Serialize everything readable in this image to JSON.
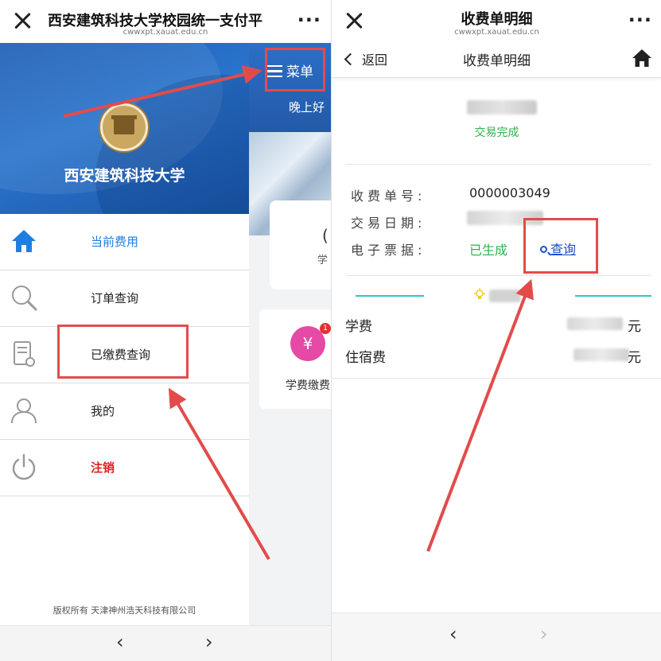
{
  "left_phone": {
    "title": "西安建筑科技大学校园统一支付平",
    "url": "cwwxpt.xauat.edu.cn",
    "more": "···",
    "school_name": "西安建筑科技大学",
    "menu_items": [
      {
        "label": "当前费用",
        "icon": "home-icon"
      },
      {
        "label": "订单查询",
        "icon": "search-icon"
      },
      {
        "label": "已缴费查询",
        "icon": "receipt-icon"
      },
      {
        "label": "我的",
        "icon": "user-icon"
      },
      {
        "label": "注销",
        "icon": "power-icon"
      }
    ],
    "copyright": "版权所有 天津神州浩天科技有限公司",
    "nav_back": "‹",
    "nav_forward": "›",
    "behind": {
      "menu_label": "菜单",
      "greeting": "晚上好",
      "card_text_1": "(",
      "card_text_2": "学",
      "pay_label": "学费缴费",
      "pay_glyph": "¥",
      "badge": "1"
    }
  },
  "right_phone": {
    "title": "收费单明细",
    "url": "cwwxpt.xauat.edu.cn",
    "more": "···",
    "back_label": "返回",
    "sub_title": "收费单明细",
    "status": "交易完成",
    "fields": {
      "bill_no_label": "收费单号:",
      "bill_no_value": "0000003049",
      "date_label": "交易日期:",
      "invoice_label": "电子票据:",
      "invoice_status": "已生成",
      "query_link": "查询"
    },
    "fees": [
      {
        "name": "学费",
        "unit": "元"
      },
      {
        "name": "住宿费",
        "unit": "元"
      }
    ],
    "nav_back": "‹",
    "nav_forward": "›"
  },
  "colors": {
    "accent_blue": "#1f7fe0",
    "header_blue": "#2a74cc",
    "success_green": "#2fb24a",
    "danger_red": "#e02020",
    "annotation_red": "#e34b4b",
    "teal": "#34c4c8"
  }
}
